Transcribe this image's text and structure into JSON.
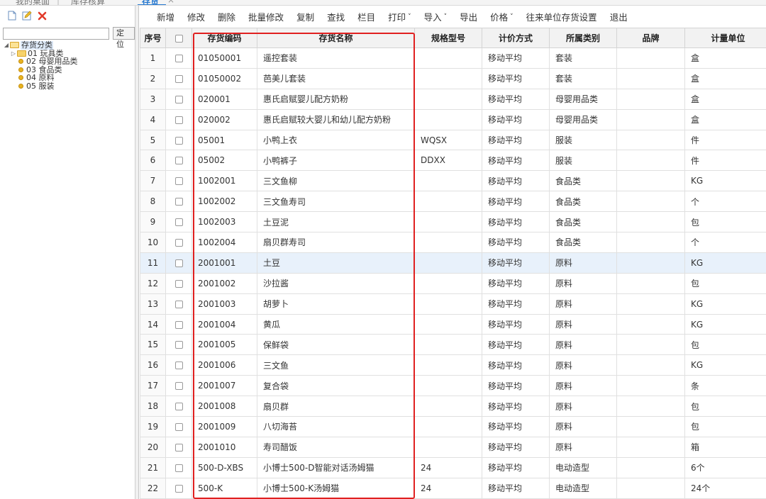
{
  "top_tabs": {
    "tab1": "我的桌面",
    "tab2": "库存核算",
    "tab3": "存货",
    "tab3_close": "×"
  },
  "left": {
    "search_placeholder": "",
    "locate_label": "定位",
    "tree": {
      "root": "存货分类",
      "items": [
        "01 玩具类",
        "02 母婴用品类",
        "03 食品类",
        "04 原料",
        "05 服装"
      ]
    }
  },
  "toolbar": [
    {
      "label": "新增",
      "dropdown": false
    },
    {
      "label": "修改",
      "dropdown": false
    },
    {
      "label": "删除",
      "dropdown": false
    },
    {
      "label": "批量修改",
      "dropdown": false
    },
    {
      "label": "复制",
      "dropdown": false
    },
    {
      "label": "查找",
      "dropdown": false
    },
    {
      "label": "栏目",
      "dropdown": false
    },
    {
      "label": "打印",
      "dropdown": true
    },
    {
      "label": "导入",
      "dropdown": true
    },
    {
      "label": "导出",
      "dropdown": false
    },
    {
      "label": "价格",
      "dropdown": true
    },
    {
      "label": "往来单位存货设置",
      "dropdown": false
    },
    {
      "label": "退出",
      "dropdown": false
    }
  ],
  "table": {
    "headers": [
      "序号",
      "",
      "存货编码",
      "存货名称",
      "规格型号",
      "计价方式",
      "所属类别",
      "品牌",
      "计量单位"
    ],
    "rows": [
      [
        "1",
        "01050001",
        "遥控套装",
        "",
        "移动平均",
        "套装",
        "",
        "盒"
      ],
      [
        "2",
        "01050002",
        "芭美儿套装",
        "",
        "移动平均",
        "套装",
        "",
        "盒"
      ],
      [
        "3",
        "020001",
        "惠氏启赋婴儿配方奶粉",
        "",
        "移动平均",
        "母婴用品类",
        "",
        "盒"
      ],
      [
        "4",
        "020002",
        "惠氏启赋较大婴儿和幼儿配方奶粉",
        "",
        "移动平均",
        "母婴用品类",
        "",
        "盒"
      ],
      [
        "5",
        "05001",
        "小鸭上衣",
        "WQSX",
        "移动平均",
        "服装",
        "",
        "件"
      ],
      [
        "6",
        "05002",
        "小鸭裤子",
        "DDXX",
        "移动平均",
        "服装",
        "",
        "件"
      ],
      [
        "7",
        "1002001",
        "三文鱼柳",
        "",
        "移动平均",
        "食品类",
        "",
        "KG"
      ],
      [
        "8",
        "1002002",
        "三文鱼寿司",
        "",
        "移动平均",
        "食品类",
        "",
        "个"
      ],
      [
        "9",
        "1002003",
        "土豆泥",
        "",
        "移动平均",
        "食品类",
        "",
        "包"
      ],
      [
        "10",
        "1002004",
        "扇贝群寿司",
        "",
        "移动平均",
        "食品类",
        "",
        "个"
      ],
      [
        "11",
        "2001001",
        "土豆",
        "",
        "移动平均",
        "原料",
        "",
        "KG"
      ],
      [
        "12",
        "2001002",
        "沙拉酱",
        "",
        "移动平均",
        "原料",
        "",
        "包"
      ],
      [
        "13",
        "2001003",
        "胡萝卜",
        "",
        "移动平均",
        "原料",
        "",
        "KG"
      ],
      [
        "14",
        "2001004",
        "黄瓜",
        "",
        "移动平均",
        "原料",
        "",
        "KG"
      ],
      [
        "15",
        "2001005",
        "保鲜袋",
        "",
        "移动平均",
        "原料",
        "",
        "包"
      ],
      [
        "16",
        "2001006",
        "三文鱼",
        "",
        "移动平均",
        "原料",
        "",
        "KG"
      ],
      [
        "17",
        "2001007",
        "复合袋",
        "",
        "移动平均",
        "原料",
        "",
        "条"
      ],
      [
        "18",
        "2001008",
        "扇贝群",
        "",
        "移动平均",
        "原料",
        "",
        "包"
      ],
      [
        "19",
        "2001009",
        "八切海苔",
        "",
        "移动平均",
        "原料",
        "",
        "包"
      ],
      [
        "20",
        "2001010",
        "寿司醋饭",
        "",
        "移动平均",
        "原料",
        "",
        "箱"
      ],
      [
        "21",
        "500-D-XBS",
        "小博士500-D智能对话汤姆猫",
        "24",
        "移动平均",
        "电动造型",
        "",
        "6个"
      ],
      [
        "22",
        "500-K",
        "小博士500-K汤姆猫",
        "24",
        "移动平均",
        "电动造型",
        "",
        "24个"
      ]
    ],
    "selected_row": 11
  },
  "colors": {
    "highlight_box": "#e02020",
    "selected_row": "#e8f1fb",
    "accent": "#2a7bd1"
  }
}
